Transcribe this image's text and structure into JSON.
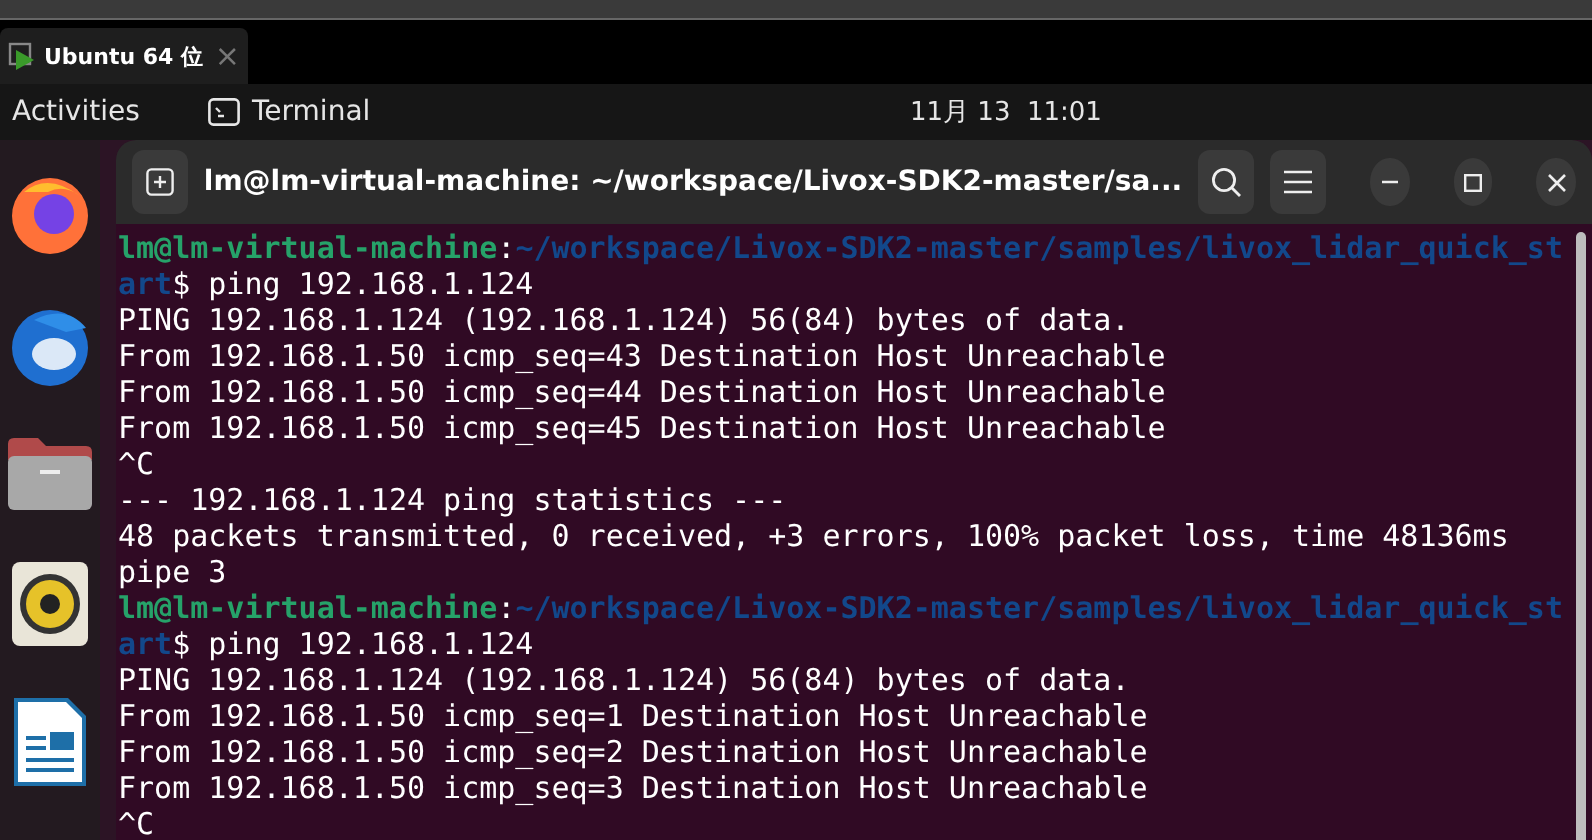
{
  "host_tab": {
    "label": "Ubuntu 64 位",
    "close": "×"
  },
  "top_bar": {
    "activities": "Activities",
    "app": "Terminal",
    "clock": "11月 13  11:01"
  },
  "terminal": {
    "title": "lm@lm-virtual-machine: ~/workspace/Livox-SDK2-master/sa...",
    "lines": [
      {
        "segments": [
          {
            "kind": "user",
            "text": "lm@lm-virtual-machine"
          },
          {
            "kind": "plain",
            "text": ":"
          },
          {
            "kind": "path",
            "text": "~/workspace/Livox-SDK2-master/samples/livox_lidar_quick_st"
          }
        ]
      },
      {
        "segments": [
          {
            "kind": "path",
            "text": "art"
          },
          {
            "kind": "plain",
            "text": "$ ping 192.168.1.124"
          }
        ]
      },
      {
        "segments": [
          {
            "kind": "plain",
            "text": "PING 192.168.1.124 (192.168.1.124) 56(84) bytes of data."
          }
        ]
      },
      {
        "segments": [
          {
            "kind": "plain",
            "text": "From 192.168.1.50 icmp_seq=43 Destination Host Unreachable"
          }
        ]
      },
      {
        "segments": [
          {
            "kind": "plain",
            "text": "From 192.168.1.50 icmp_seq=44 Destination Host Unreachable"
          }
        ]
      },
      {
        "segments": [
          {
            "kind": "plain",
            "text": "From 192.168.1.50 icmp_seq=45 Destination Host Unreachable"
          }
        ]
      },
      {
        "segments": [
          {
            "kind": "plain",
            "text": "^C"
          }
        ]
      },
      {
        "segments": [
          {
            "kind": "plain",
            "text": "--- 192.168.1.124 ping statistics ---"
          }
        ]
      },
      {
        "segments": [
          {
            "kind": "plain",
            "text": "48 packets transmitted, 0 received, +3 errors, 100% packet loss, time 48136ms"
          }
        ]
      },
      {
        "segments": [
          {
            "kind": "plain",
            "text": "pipe 3"
          }
        ]
      },
      {
        "segments": [
          {
            "kind": "user",
            "text": "lm@lm-virtual-machine"
          },
          {
            "kind": "plain",
            "text": ":"
          },
          {
            "kind": "path",
            "text": "~/workspace/Livox-SDK2-master/samples/livox_lidar_quick_st"
          }
        ]
      },
      {
        "segments": [
          {
            "kind": "path",
            "text": "art"
          },
          {
            "kind": "plain",
            "text": "$ ping 192.168.1.124"
          }
        ]
      },
      {
        "segments": [
          {
            "kind": "plain",
            "text": "PING 192.168.1.124 (192.168.1.124) 56(84) bytes of data."
          }
        ]
      },
      {
        "segments": [
          {
            "kind": "plain",
            "text": "From 192.168.1.50 icmp_seq=1 Destination Host Unreachable"
          }
        ]
      },
      {
        "segments": [
          {
            "kind": "plain",
            "text": "From 192.168.1.50 icmp_seq=2 Destination Host Unreachable"
          }
        ]
      },
      {
        "segments": [
          {
            "kind": "plain",
            "text": "From 192.168.1.50 icmp_seq=3 Destination Host Unreachable"
          }
        ]
      },
      {
        "segments": [
          {
            "kind": "plain",
            "text": "^C"
          }
        ]
      }
    ]
  }
}
